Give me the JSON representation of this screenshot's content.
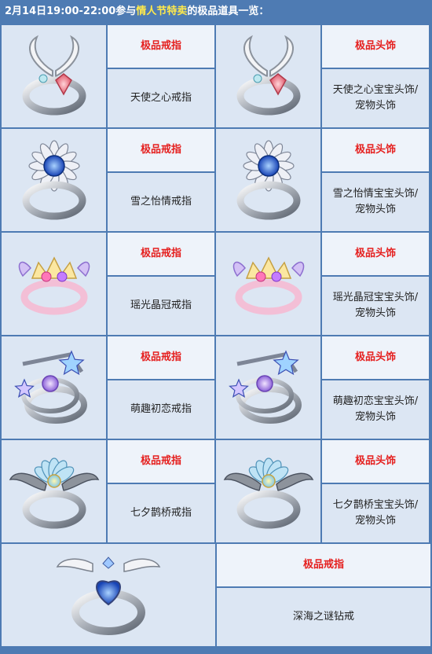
{
  "header": {
    "part1": "2月14日19:00-22:00",
    "part2": "参与",
    "part3": "情人节特卖",
    "part4": "的极品道具一览："
  },
  "colors": {
    "border": "#4e7bb3",
    "title_red": "#e5201f",
    "cell_bg": "#dce6f3",
    "title_bg": "#eef3fa",
    "highlight": "#ffe94b"
  },
  "rows": [
    {
      "left": {
        "title": "极品戒指",
        "name_line1": "天使之心戒指",
        "name_line2": "",
        "icon": "angel-heart-ring-icon"
      },
      "right": {
        "title": "极品头饰",
        "name_line1": "天使之心宝宝头饰/",
        "name_line2": "宠物头饰",
        "icon": "angel-heart-ring-icon"
      }
    },
    {
      "left": {
        "title": "极品戒指",
        "name_line1": "雪之怡情戒指",
        "name_line2": "",
        "icon": "snow-flower-ring-icon"
      },
      "right": {
        "title": "极品头饰",
        "name_line1": "雪之怡情宝宝头饰/",
        "name_line2": "宠物头饰",
        "icon": "snow-flower-ring-icon"
      }
    },
    {
      "left": {
        "title": "极品戒指",
        "name_line1": "瑶光晶冠戒指",
        "name_line2": "",
        "icon": "crown-ring-icon"
      },
      "right": {
        "title": "极品头饰",
        "name_line1": "瑶光晶冠宝宝头饰/",
        "name_line2": "宠物头饰",
        "icon": "crown-ring-icon"
      }
    },
    {
      "left": {
        "title": "极品戒指",
        "name_line1": "萌趣初恋戒指",
        "name_line2": "",
        "icon": "star-ring-icon"
      },
      "right": {
        "title": "极品头饰",
        "name_line1": "萌趣初恋宝宝头饰/",
        "name_line2": "宠物头饰",
        "icon": "star-ring-icon"
      }
    },
    {
      "left": {
        "title": "极品戒指",
        "name_line1": "七夕鹊桥戒指",
        "name_line2": "",
        "icon": "lotus-wing-ring-icon"
      },
      "right": {
        "title": "极品头饰",
        "name_line1": "七夕鹊桥宝宝头饰/",
        "name_line2": "宠物头饰",
        "icon": "lotus-wing-ring-icon"
      }
    }
  ],
  "last": {
    "title": "极品戒指",
    "name": "深海之谜钻戒",
    "icon": "winged-diamond-ring-icon"
  }
}
